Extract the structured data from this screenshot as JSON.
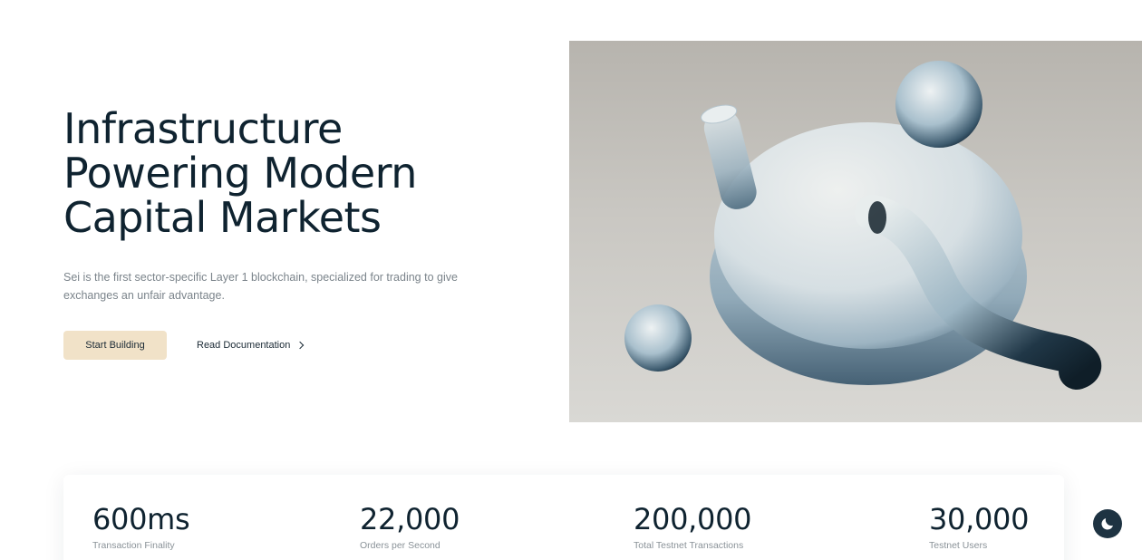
{
  "hero": {
    "title_lines": [
      "Infrastructure",
      "Powering Modern",
      "Capital Markets"
    ],
    "description": "Sei is the first sector-specific Layer 1 blockchain, specialized for trading to give exchanges an unfair advantage.",
    "primary_button": "Start Building",
    "secondary_link": "Read Documentation",
    "image_icon": "abstract-3d-glass-shapes"
  },
  "stats": [
    {
      "value": "600ms",
      "label": "Transaction Finality"
    },
    {
      "value": "22,000",
      "label": "Orders per Second"
    },
    {
      "value": "200,000",
      "label": "Total Testnet Transactions"
    },
    {
      "value": "30,000",
      "label": "Testnet Users"
    }
  ],
  "theme_toggle": {
    "icon": "moon-icon"
  },
  "colors": {
    "primary_text": "#0f2330",
    "button_bg": "#f1e2c8",
    "muted_text": "#7b848b",
    "toggle_bg": "#1e3342"
  }
}
